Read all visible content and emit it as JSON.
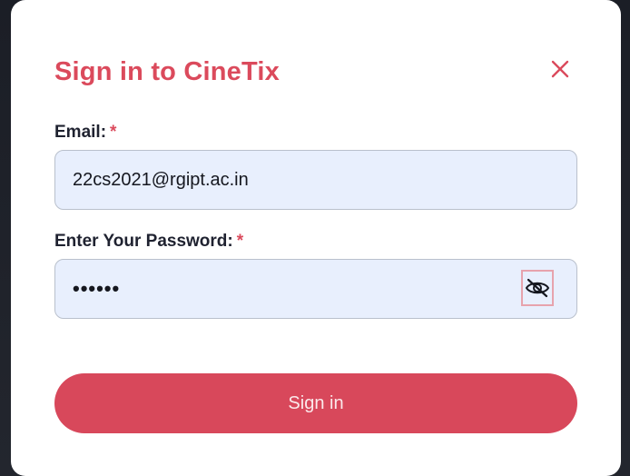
{
  "modal": {
    "title": "Sign in to CineTix"
  },
  "email": {
    "label": "Email:",
    "required_mark": "*",
    "value": "22cs2021@rgipt.ac.in"
  },
  "password": {
    "label": "Enter Your Password:",
    "required_mark": "*",
    "masked_value": "••••••",
    "toggle_icon": "eye-slash-icon"
  },
  "actions": {
    "submit_label": "Sign in"
  },
  "colors": {
    "accent": "#db4a5c",
    "input_bg": "#e8effd",
    "button_bg": "#d8485b"
  }
}
